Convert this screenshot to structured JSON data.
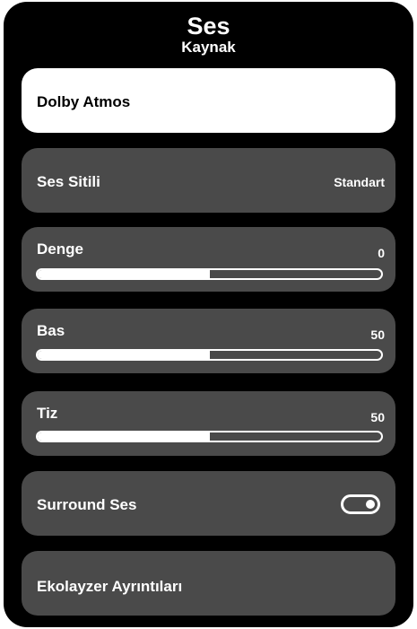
{
  "header": {
    "title": "Ses",
    "subtitle": "Kaynak"
  },
  "menu": {
    "dolby_atmos": {
      "label": "Dolby Atmos"
    },
    "ses_sitili": {
      "label": "Ses Sitili",
      "value": "Standart"
    },
    "denge": {
      "label": "Denge",
      "value": "0",
      "level_fraction": 0.5
    },
    "bas": {
      "label": "Bas",
      "value": "50",
      "level_fraction": 0.5
    },
    "tiz": {
      "label": "Tiz",
      "value": "50",
      "level_fraction": 0.5
    },
    "surround": {
      "label": "Surround Ses",
      "enabled": true
    },
    "ekolayzer": {
      "label": "Ekolayzer Ayrıntıları"
    }
  },
  "colors": {
    "background": "#000000",
    "item_background": "#4a4a4a",
    "selected_background": "#ffffff",
    "text": "#ffffff"
  }
}
